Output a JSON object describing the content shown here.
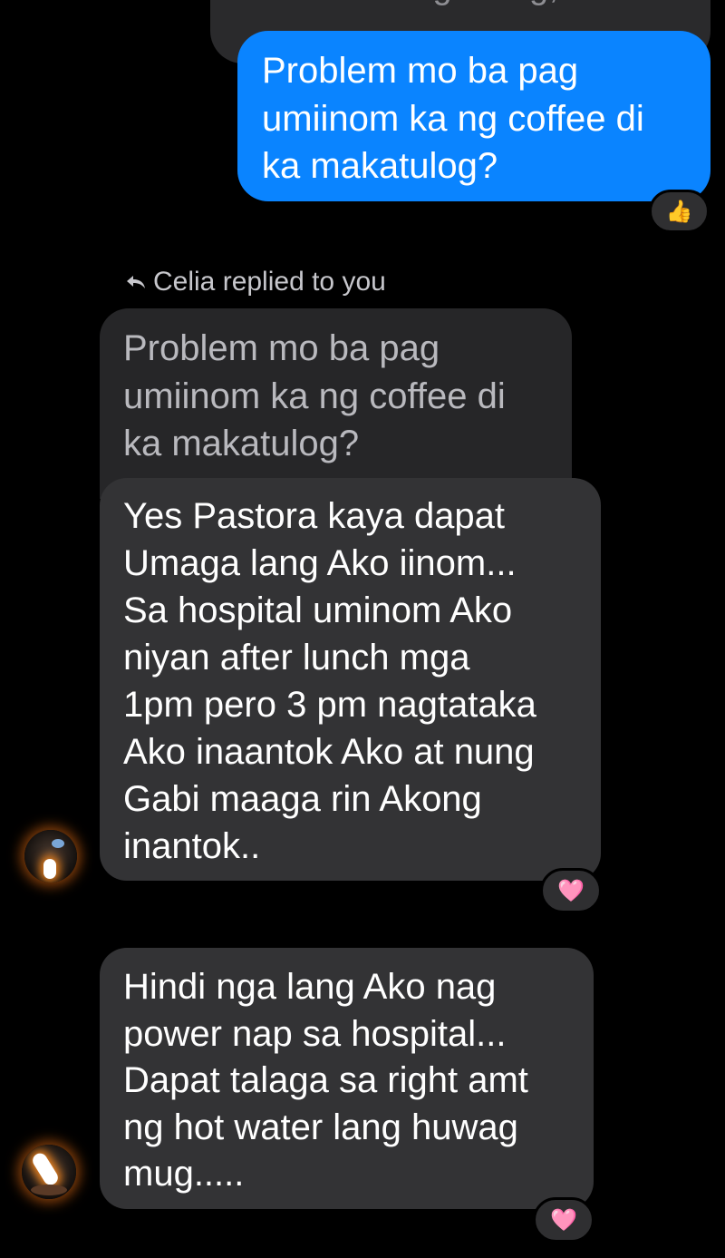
{
  "previous_message": {
    "text": "ideal sa umaga lang, Ah"
  },
  "outgoing": {
    "lines": [
      "Problem mo ba pag",
      "umiinom ka ng coffee di",
      "ka makatulog?"
    ],
    "reaction": "👍"
  },
  "reply_indicator": {
    "text": "Celia replied to you"
  },
  "quoted": {
    "lines": [
      "Problem mo ba pag",
      "umiinom ka ng coffee di",
      "ka makatulog?"
    ]
  },
  "messages": [
    {
      "lines": [
        "Yes Pastora kaya dapat",
        "Umaga lang Ako iinom...",
        "Sa hospital uminom Ako",
        "niyan after lunch mga",
        "1pm pero 3 pm nagtataka",
        "Ako inaantok Ako at nung",
        "Gabi maaga rin Akong",
        "inantok.."
      ],
      "reaction": "🩷"
    },
    {
      "lines": [
        "Hindi nga lang Ako nag",
        "power nap sa hospital...",
        "Dapat talaga sa right amt",
        "ng hot water lang huwag",
        "mug....."
      ],
      "reaction": "🩷"
    }
  ],
  "colors": {
    "background": "#000000",
    "outgoing_bubble": "#0a84ff",
    "incoming_bubble": "#333335",
    "quoted_bubble": "#262628"
  }
}
